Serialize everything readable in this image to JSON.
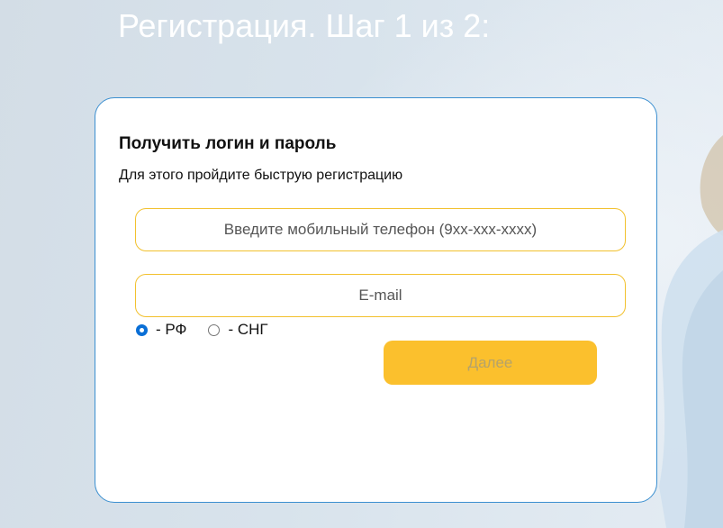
{
  "page": {
    "title": "Регистрация. Шаг 1 из 2:"
  },
  "form": {
    "heading": "Получить логин и пароль",
    "subheading": "Для этого пройдите быструю регистрацию",
    "phone": {
      "placeholder": "Введите мобильный телефон (9xx-xxx-xxxx)",
      "value": ""
    },
    "email": {
      "placeholder": "E-mail",
      "value": ""
    },
    "region_options": [
      {
        "label": "- РФ",
        "checked": true
      },
      {
        "label": "- СНГ",
        "checked": false
      }
    ],
    "next_label": "Далее"
  },
  "colors": {
    "card_border": "#3b8fd0",
    "field_border": "#f2c12e",
    "button_bg": "#fbc02d",
    "radio_checked": "#0a6fd6"
  }
}
